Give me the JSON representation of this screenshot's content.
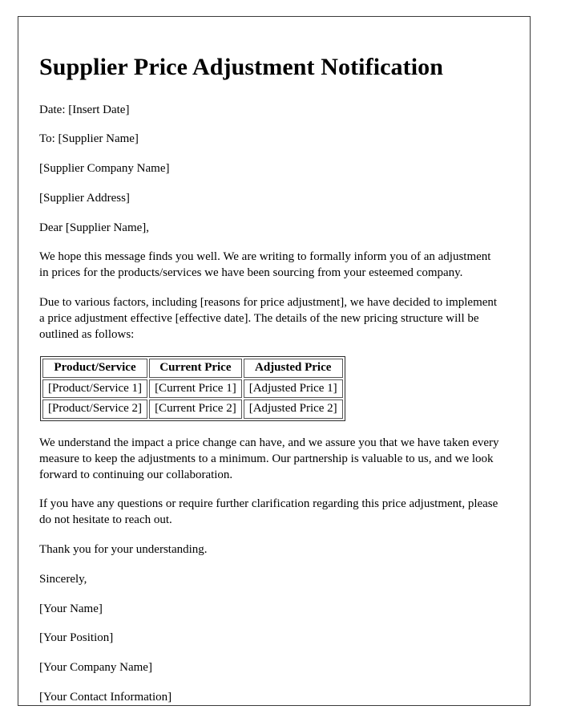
{
  "document": {
    "title": "Supplier Price Adjustment Notification",
    "date_line": "Date: [Insert Date]",
    "to_line": "To: [Supplier Name]",
    "supplier_company": "[Supplier Company Name]",
    "supplier_address": "[Supplier Address]",
    "salutation": "Dear [Supplier Name],",
    "paragraph_1": "We hope this message finds you well. We are writing to formally inform you of an adjustment in prices for the products/services we have been sourcing from your esteemed company.",
    "paragraph_2": "Due to various factors, including [reasons for price adjustment], we have decided to implement a price adjustment effective [effective date]. The details of the new pricing structure will be outlined as follows:",
    "paragraph_3": "We understand the impact a price change can have, and we assure you that we have taken every measure to keep the adjustments to a minimum. Our partnership is valuable to us, and we look forward to continuing our collaboration.",
    "paragraph_4": "If you have any questions or require further clarification regarding this price adjustment, please do not hesitate to reach out.",
    "thanks": "Thank you for your understanding.",
    "closing": "Sincerely,",
    "signature": {
      "name": "[Your Name]",
      "position": "[Your Position]",
      "company": "[Your Company Name]",
      "contact": "[Your Contact Information]"
    }
  },
  "price_table": {
    "headers": [
      "Product/Service",
      "Current Price",
      "Adjusted Price"
    ],
    "rows": [
      [
        "[Product/Service 1]",
        "[Current Price 1]",
        "[Adjusted Price 1]"
      ],
      [
        "[Product/Service 2]",
        "[Current Price 2]",
        "[Adjusted Price 2]"
      ]
    ]
  },
  "colors": {
    "page_border": "#3a3a3a",
    "text": "#000000",
    "table_border": "#555555",
    "background": "#ffffff"
  }
}
